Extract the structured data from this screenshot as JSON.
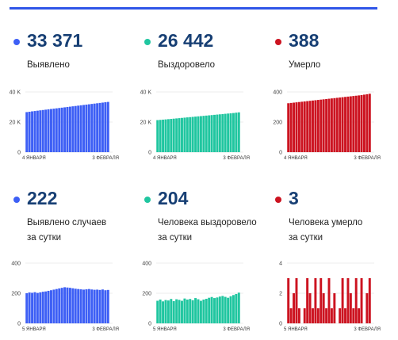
{
  "colors": {
    "blue": "#3d5ff5",
    "green": "#20c6a0",
    "red": "#cc1320",
    "value_text": "#173f74",
    "top_bar": "#2f55e8"
  },
  "panels": [
    {
      "value": "33 371",
      "label": "Выявлено",
      "color": "#3d5ff5"
    },
    {
      "value": "26 442",
      "label": "Выздоровело",
      "color": "#20c6a0"
    },
    {
      "value": "388",
      "label": "Умерло",
      "color": "#cc1320"
    },
    {
      "value": "222",
      "label": "Выявлено случаев\nза сутки",
      "color": "#3d5ff5"
    },
    {
      "value": "204",
      "label": "Человека выздоровело\nза сутки",
      "color": "#20c6a0"
    },
    {
      "value": "3",
      "label": "Человека умерло\nза сутки",
      "color": "#cc1320"
    }
  ],
  "chart_data": [
    {
      "type": "bar",
      "title": "Выявлено",
      "x_start": "4 ЯНВАРЯ",
      "x_end": "3 ФЕВРАЛЯ",
      "yticks": [
        "0",
        "20 K",
        "40 K"
      ],
      "ylim": [
        0,
        40000
      ],
      "color": "#3d5ff5",
      "values": [
        26600,
        26850,
        27100,
        27320,
        27550,
        27780,
        28000,
        28230,
        28460,
        28680,
        28900,
        29120,
        29340,
        29560,
        29780,
        30000,
        30220,
        30450,
        30680,
        30900,
        31130,
        31360,
        31580,
        31800,
        32030,
        32250,
        32470,
        32700,
        32920,
        33150,
        33371
      ]
    },
    {
      "type": "bar",
      "title": "Выздоровело",
      "x_start": "4 ЯНВАРЯ",
      "x_end": "3 ФЕВРАЛЯ",
      "yticks": [
        "0",
        "20 K",
        "40 K"
      ],
      "ylim": [
        0,
        40000
      ],
      "color": "#20c6a0",
      "values": [
        21300,
        21450,
        21600,
        21760,
        21920,
        22080,
        22250,
        22420,
        22590,
        22760,
        22930,
        23100,
        23270,
        23440,
        23610,
        23780,
        23950,
        24120,
        24290,
        24460,
        24630,
        24800,
        24970,
        25140,
        25310,
        25480,
        25650,
        25820,
        25990,
        26238,
        26442
      ]
    },
    {
      "type": "bar",
      "title": "Умерло",
      "x_start": "4 ЯНВАРЯ",
      "x_end": "3 ФЕВРАЛЯ",
      "yticks": [
        "0",
        "200",
        "400"
      ],
      "ylim": [
        0,
        400
      ],
      "color": "#cc1320",
      "values": [
        325,
        327,
        329,
        331,
        333,
        335,
        337,
        339,
        341,
        343,
        345,
        347,
        349,
        351,
        353,
        355,
        357,
        359,
        361,
        363,
        365,
        367,
        369,
        371,
        373,
        375,
        377,
        379,
        382,
        385,
        388
      ]
    },
    {
      "type": "bar",
      "title": "Выявлено случаев за сутки",
      "x_start": "5 ЯНВАРЯ",
      "x_end": "3 ФЕВРАЛЯ",
      "yticks": [
        "0",
        "200",
        "400"
      ],
      "ylim": [
        0,
        400
      ],
      "color": "#3d5ff5",
      "values": [
        200,
        205,
        203,
        207,
        202,
        206,
        210,
        212,
        216,
        220,
        224,
        228,
        232,
        236,
        240,
        238,
        236,
        233,
        230,
        228,
        226,
        224,
        226,
        228,
        225,
        223,
        224,
        222,
        225,
        220,
        222
      ]
    },
    {
      "type": "bar",
      "title": "Человека выздоровело за сутки",
      "x_start": "5 ЯНВАРЯ",
      "x_end": "3 ФЕВРАЛЯ",
      "yticks": [
        "0",
        "200",
        "400"
      ],
      "ylim": [
        0,
        400
      ],
      "color": "#20c6a0",
      "values": [
        150,
        158,
        146,
        155,
        152,
        162,
        148,
        160,
        156,
        150,
        165,
        158,
        162,
        154,
        168,
        160,
        150,
        158,
        163,
        170,
        175,
        168,
        172,
        178,
        182,
        176,
        170,
        180,
        188,
        195,
        204
      ]
    },
    {
      "type": "bar",
      "title": "Человека умерло за сутки",
      "x_start": "5 ЯНВАРЯ",
      "x_end": "3 ФЕВРАЛЯ",
      "yticks": [
        "0",
        "2",
        "4"
      ],
      "ylim": [
        0,
        4
      ],
      "color": "#cc1320",
      "values": [
        3,
        1,
        2,
        3,
        1,
        0,
        1,
        3,
        2,
        1,
        3,
        1,
        3,
        2,
        1,
        3,
        1,
        2,
        0,
        1,
        3,
        1,
        3,
        2,
        1,
        3,
        1,
        3,
        0,
        2,
        3
      ]
    }
  ]
}
